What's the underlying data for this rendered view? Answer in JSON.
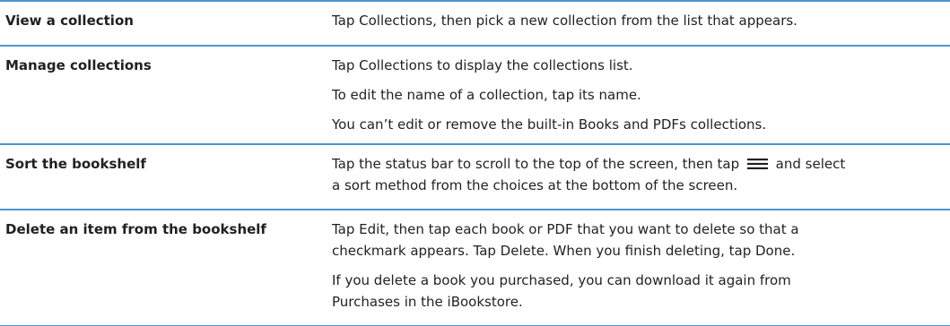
{
  "colors": {
    "rule": "#4a95d0",
    "text": "#231f20"
  },
  "rows": [
    {
      "name": "View a collection",
      "lines": [
        "Tap Collections, then pick a new collection from the list that appears."
      ]
    },
    {
      "name": "Manage collections",
      "lines": [
        "Tap Collections to display the collections list.",
        "To edit the name of a collection, tap its name.",
        "You can’t edit or remove the built-in Books and PDFs collections."
      ]
    },
    {
      "name": "Sort the bookshelf",
      "line1_before_icon": "Tap the status bar to scroll to the top of the screen, then tap",
      "icon": "list-menu-icon",
      "line1_after_icon": "and select",
      "line2": "a sort method from the choices at the bottom of the screen."
    },
    {
      "name": "Delete an item from the bookshelf",
      "lines": [
        "Tap Edit, then tap each book or PDF that you want to delete so that a",
        "checkmark appears. Tap Delete. When you finish deleting, tap Done.",
        "If you delete a book you purchased, you can download it again from",
        "Purchases in the iBookstore."
      ]
    }
  ]
}
